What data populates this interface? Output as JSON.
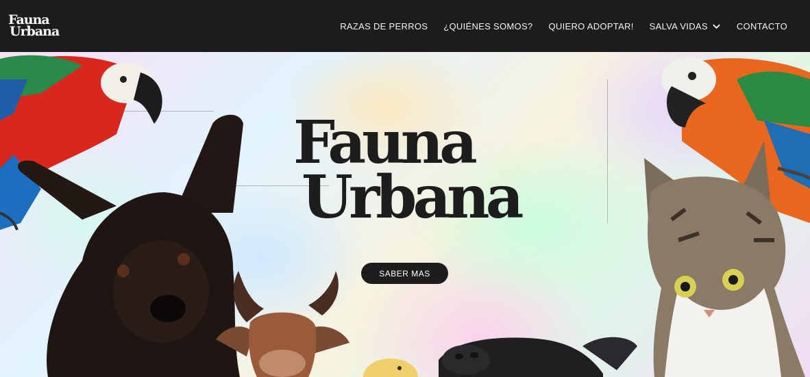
{
  "brand": {
    "line1": "Fauna",
    "line2": "Urbana"
  },
  "nav": {
    "items": [
      {
        "label": "RAZAS DE PERROS"
      },
      {
        "label": "¿QUIÉNES SOMOS?"
      },
      {
        "label": "QUIERO ADOPTAR!"
      },
      {
        "label": "SALVA VIDAS"
      },
      {
        "label": "CONTACTO"
      }
    ]
  },
  "hero": {
    "title_line1": "Fauna",
    "title_line2": "Urbana",
    "cta_label": "SABER MAS",
    "animals": [
      "parrot-left",
      "dog",
      "cow",
      "duckling",
      "pig",
      "parrot-right",
      "cat"
    ]
  },
  "colors": {
    "nav_bg": "#1b1c1b",
    "text_dark": "#1c1d1c",
    "nav_text": "#f4f4f4"
  }
}
